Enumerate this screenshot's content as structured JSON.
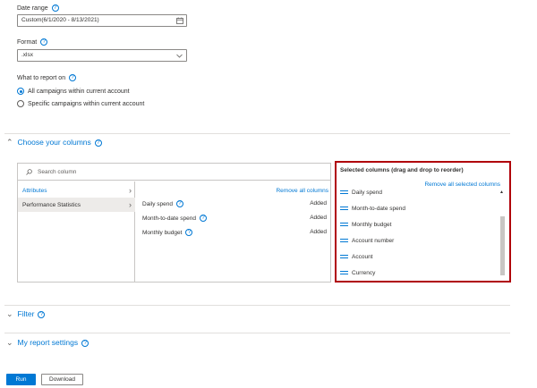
{
  "date_range": {
    "label": "Date range",
    "value": "Custom(6/1/2020 - 8/13/2021)"
  },
  "format": {
    "label": "Format",
    "value": ".xlsx"
  },
  "report_on": {
    "label": "What to report on",
    "options": [
      "All campaigns within current account",
      "Specific campaigns within current account"
    ]
  },
  "choose_columns": {
    "title": "Choose your columns",
    "search_placeholder": "Search column",
    "categories": [
      "Attributes",
      "Performance Statistics"
    ],
    "remove_all": "Remove all columns",
    "columns": [
      {
        "name": "Daily spend",
        "status": "Added"
      },
      {
        "name": "Month-to-date spend",
        "status": "Added"
      },
      {
        "name": "Monthly budget",
        "status": "Added"
      }
    ]
  },
  "selected": {
    "title": "Selected columns (drag and drop to reorder)",
    "remove_all": "Remove all selected columns",
    "items": [
      "Daily spend",
      "Month-to-date spend",
      "Monthly budget",
      "Account number",
      "Account",
      "Currency"
    ]
  },
  "filter": {
    "title": "Filter"
  },
  "my_settings": {
    "title": "My report settings"
  },
  "buttons": {
    "run": "Run",
    "download": "Download"
  },
  "colors": {
    "accent": "#0078d4",
    "highlight_border": "#b0000b"
  }
}
